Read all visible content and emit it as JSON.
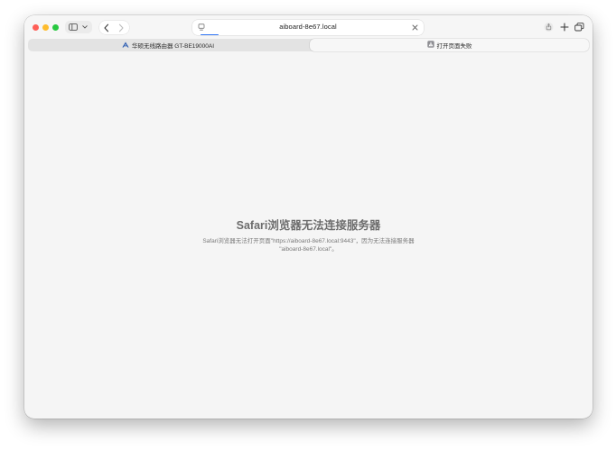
{
  "window": {
    "traffic_lights": {
      "close": "#fe5f57",
      "minimize": "#febc2e",
      "zoom": "#28c840"
    },
    "toolbar": {
      "sidebar_icon": "sidebar-icon",
      "back_icon": "chevron-left-icon",
      "forward_icon": "chevron-right-icon",
      "address": {
        "text": "aiboard-8e67.local"
      },
      "share_icon": "share-icon",
      "new_tab_icon": "plus-icon",
      "tab_overview_icon": "tab-overview-icon"
    },
    "tabs": [
      {
        "label": "华硕无线路由器 GT-BE19000AI",
        "icon": "asus-logo-icon",
        "active": false
      },
      {
        "label": "打开页面失败",
        "icon": "safari-warning-icon",
        "active": true
      }
    ]
  },
  "error_page": {
    "title": "Safari浏览器无法连接服务器",
    "message_line1": "Safari浏览器无法打开页面\"https://aiboard-8e67.local:9443\"，因为无法连接服务器",
    "message_line2": "\"aiboard-8e67.local\"。"
  },
  "accent_color": "#3478f6"
}
